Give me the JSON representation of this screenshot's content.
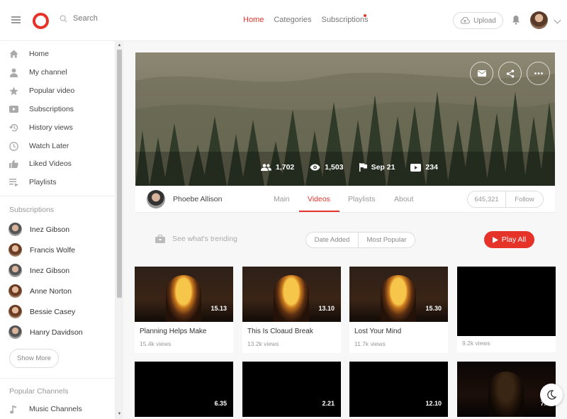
{
  "header": {
    "search_placeholder": "Search",
    "nav": [
      {
        "label": "Home"
      },
      {
        "label": "Categories"
      },
      {
        "label": "Subscriptions"
      }
    ],
    "upload_label": "Upload"
  },
  "sidebar": {
    "items": [
      {
        "label": "Home",
        "icon": "home-icon"
      },
      {
        "label": "My channel",
        "icon": "user-icon"
      },
      {
        "label": "Popular video",
        "icon": "star-icon"
      },
      {
        "label": "Subscriptions",
        "icon": "subscriptions-icon"
      },
      {
        "label": "History views",
        "icon": "history-icon"
      },
      {
        "label": "Watch Later",
        "icon": "clock-icon"
      },
      {
        "label": "Liked Videos",
        "icon": "thumbs-up-icon"
      },
      {
        "label": "Playlists",
        "icon": "playlist-icon"
      }
    ],
    "subscriptions_title": "Subscriptions",
    "subscriptions": [
      {
        "name": "Inez Gibson"
      },
      {
        "name": "Francis Wolfe"
      },
      {
        "name": "Inez Gibson"
      },
      {
        "name": "Anne Norton"
      },
      {
        "name": "Bessie Casey"
      },
      {
        "name": "Hanry Davidson"
      }
    ],
    "show_more": "Show More",
    "popular_channels_title": "Popular Channels",
    "popular_channels": [
      {
        "label": "Music Channels",
        "icon": "music-note-icon"
      }
    ]
  },
  "channel": {
    "stats": {
      "subscribers": "1,702",
      "views": "1,503",
      "joined": "Sep 21",
      "videos": "234"
    },
    "name": "Phoebe Allison",
    "tabs": [
      {
        "label": "Main"
      },
      {
        "label": "Videos"
      },
      {
        "label": "Playlists"
      },
      {
        "label": "About"
      }
    ],
    "follower_count": "645,321",
    "follow_label": "Follow"
  },
  "toolbar": {
    "trending_label": "See what's trending",
    "sort_date": "Date Added",
    "sort_popular": "Most Popular",
    "play_all": "Play All"
  },
  "videos": [
    {
      "title": "Planning Helps Make",
      "views": "15.4k views",
      "duration": "15.13"
    },
    {
      "title": "This Is Cloaud Break",
      "views": "13.2k views",
      "duration": "13.10"
    },
    {
      "title": "Lost Your Mind",
      "views": "11.7k views",
      "duration": "15.30"
    },
    {
      "title": "",
      "views": "9.2k views",
      "duration": ""
    },
    {
      "title": "",
      "views": "",
      "duration": "6.35"
    },
    {
      "title": "",
      "views": "",
      "duration": "2.21"
    },
    {
      "title": "",
      "views": "",
      "duration": "12.10"
    },
    {
      "title": "",
      "views": "",
      "duration": "7.5"
    }
  ],
  "colors": {
    "accent": "#e5332a"
  }
}
